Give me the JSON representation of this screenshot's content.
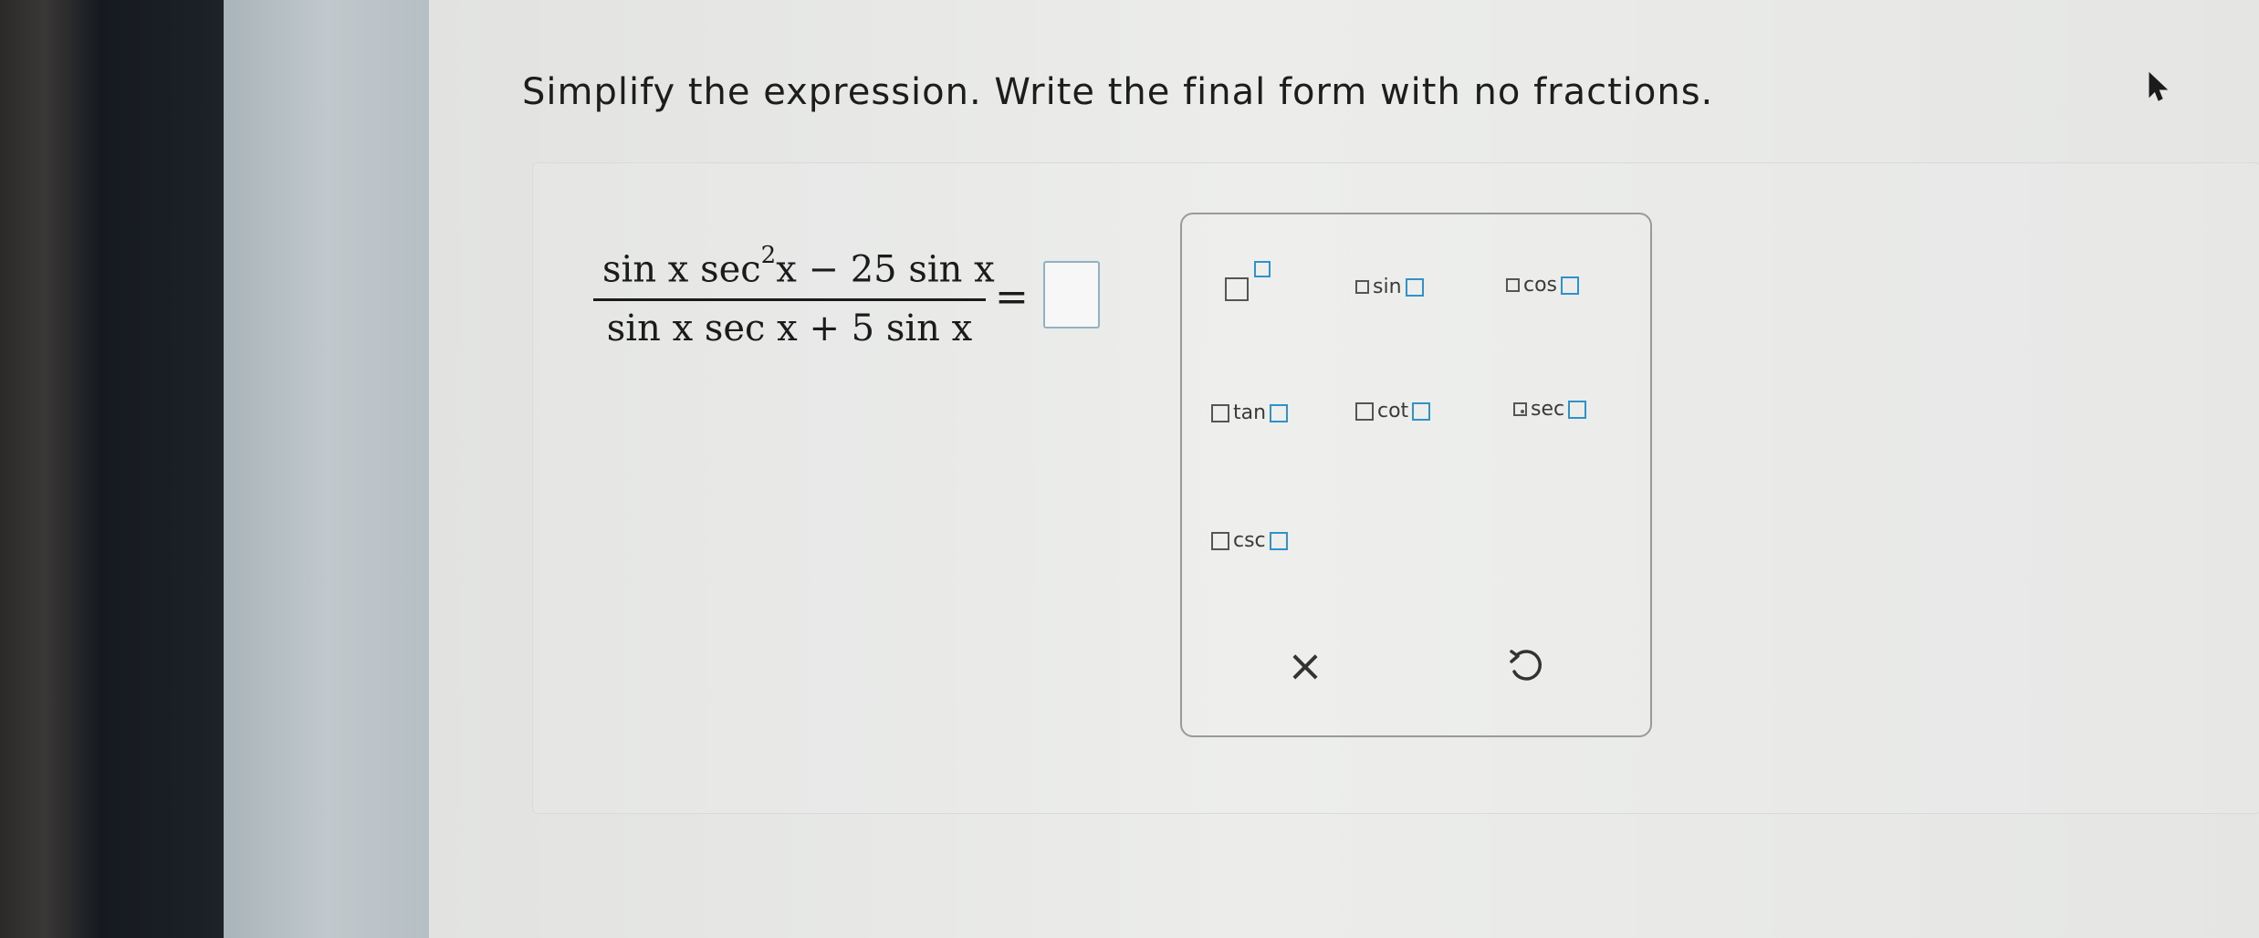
{
  "question": {
    "instruction": "Simplify the expression. Write the final form with no fractions."
  },
  "expression": {
    "numerator_part1": "sin x sec",
    "numerator_exponent": "2",
    "numerator_part2": "x − 25 sin x",
    "denominator": "sin x sec x + 5 sin x",
    "equals": "="
  },
  "answer": {
    "value": ""
  },
  "palette": {
    "buttons": [
      {
        "id": "power",
        "label": ""
      },
      {
        "id": "sin",
        "label": "sin"
      },
      {
        "id": "cos",
        "label": "cos"
      },
      {
        "id": "tan",
        "label": "tan"
      },
      {
        "id": "cot",
        "label": "cot"
      },
      {
        "id": "sec",
        "label": "sec"
      },
      {
        "id": "csc",
        "label": "csc"
      }
    ],
    "clear_symbol": "×",
    "undo_icon": "undo-icon"
  },
  "colors": {
    "accent": "#2d93c8",
    "text": "#1b1b1b",
    "palette_border": "#9a9a98"
  }
}
